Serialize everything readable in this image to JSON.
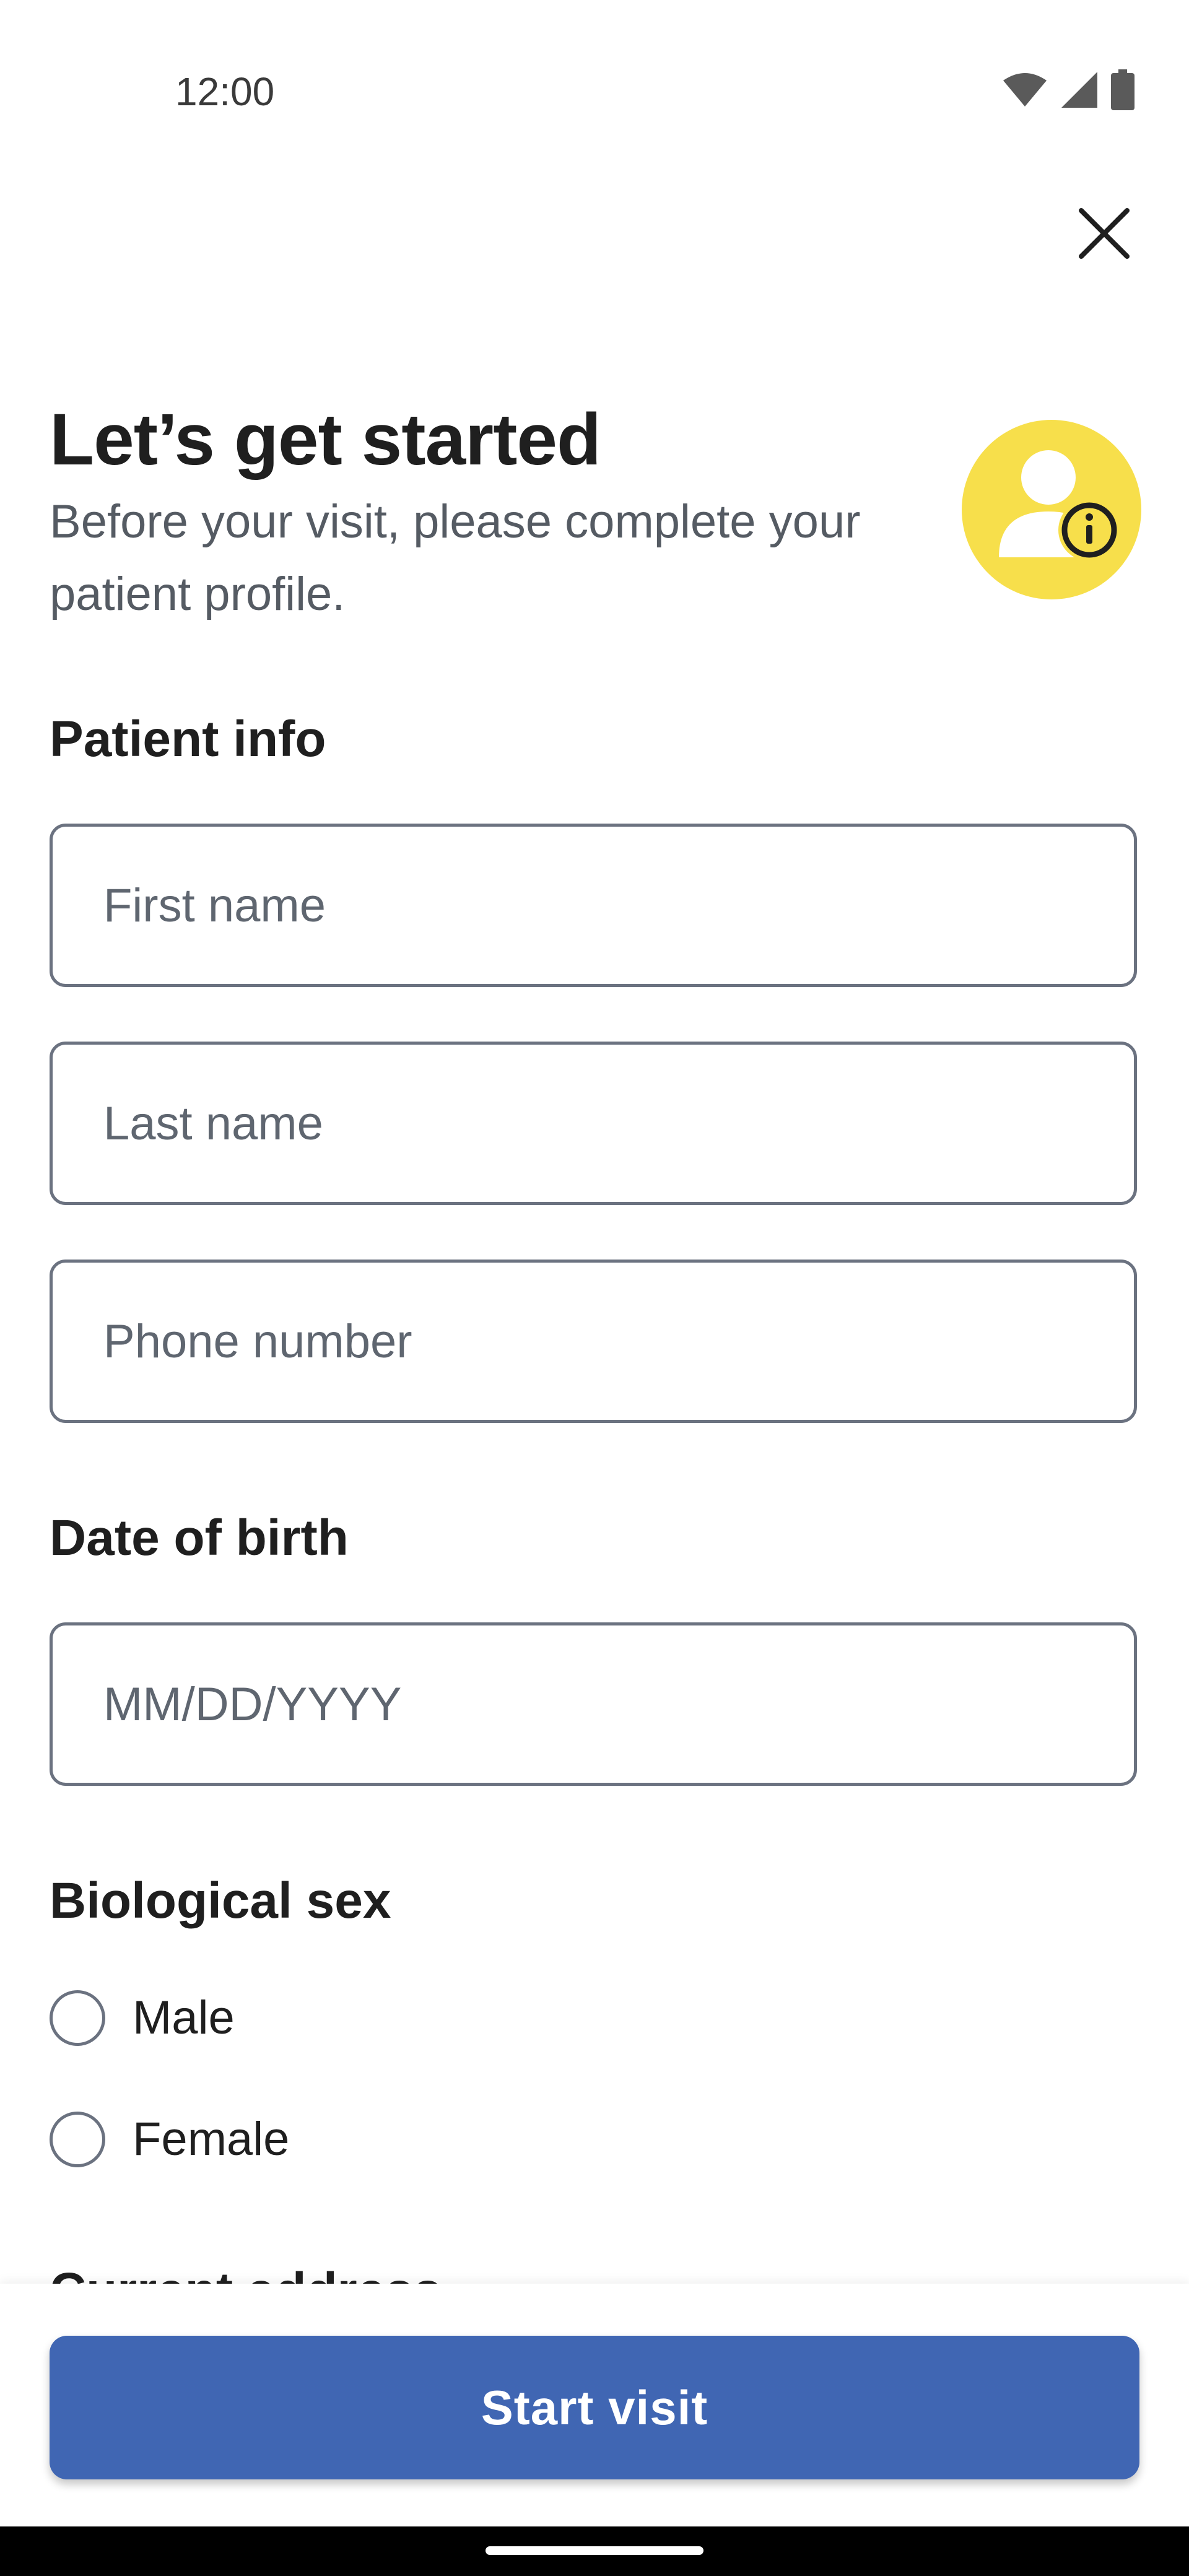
{
  "status_bar": {
    "time": "12:00",
    "icons": [
      "wifi-icon",
      "signal-icon",
      "battery-icon"
    ]
  },
  "header": {
    "close_icon": "close-icon",
    "title": "Let’s get started",
    "subtitle": "Before your visit, please complete your patient profile.",
    "avatar_icon": "user-info-icon"
  },
  "patient_info": {
    "title": "Patient info",
    "first_name": {
      "placeholder": "First name",
      "value": ""
    },
    "last_name": {
      "placeholder": "Last name",
      "value": ""
    },
    "phone": {
      "placeholder": "Phone number",
      "value": ""
    }
  },
  "date_of_birth": {
    "title": "Date of birth",
    "placeholder": "MM/DD/YYYY",
    "value": ""
  },
  "biological_sex": {
    "title": "Biological sex",
    "options": [
      {
        "label": "Male",
        "selected": false
      },
      {
        "label": "Female",
        "selected": false
      }
    ]
  },
  "current_address": {
    "title": "Current address"
  },
  "actions": {
    "start_visit": "Start visit"
  },
  "colors": {
    "primary": "#4066b3",
    "avatar_bg": "#f7df4b",
    "border": "#6b7280",
    "subtitle_text": "#555b63"
  }
}
